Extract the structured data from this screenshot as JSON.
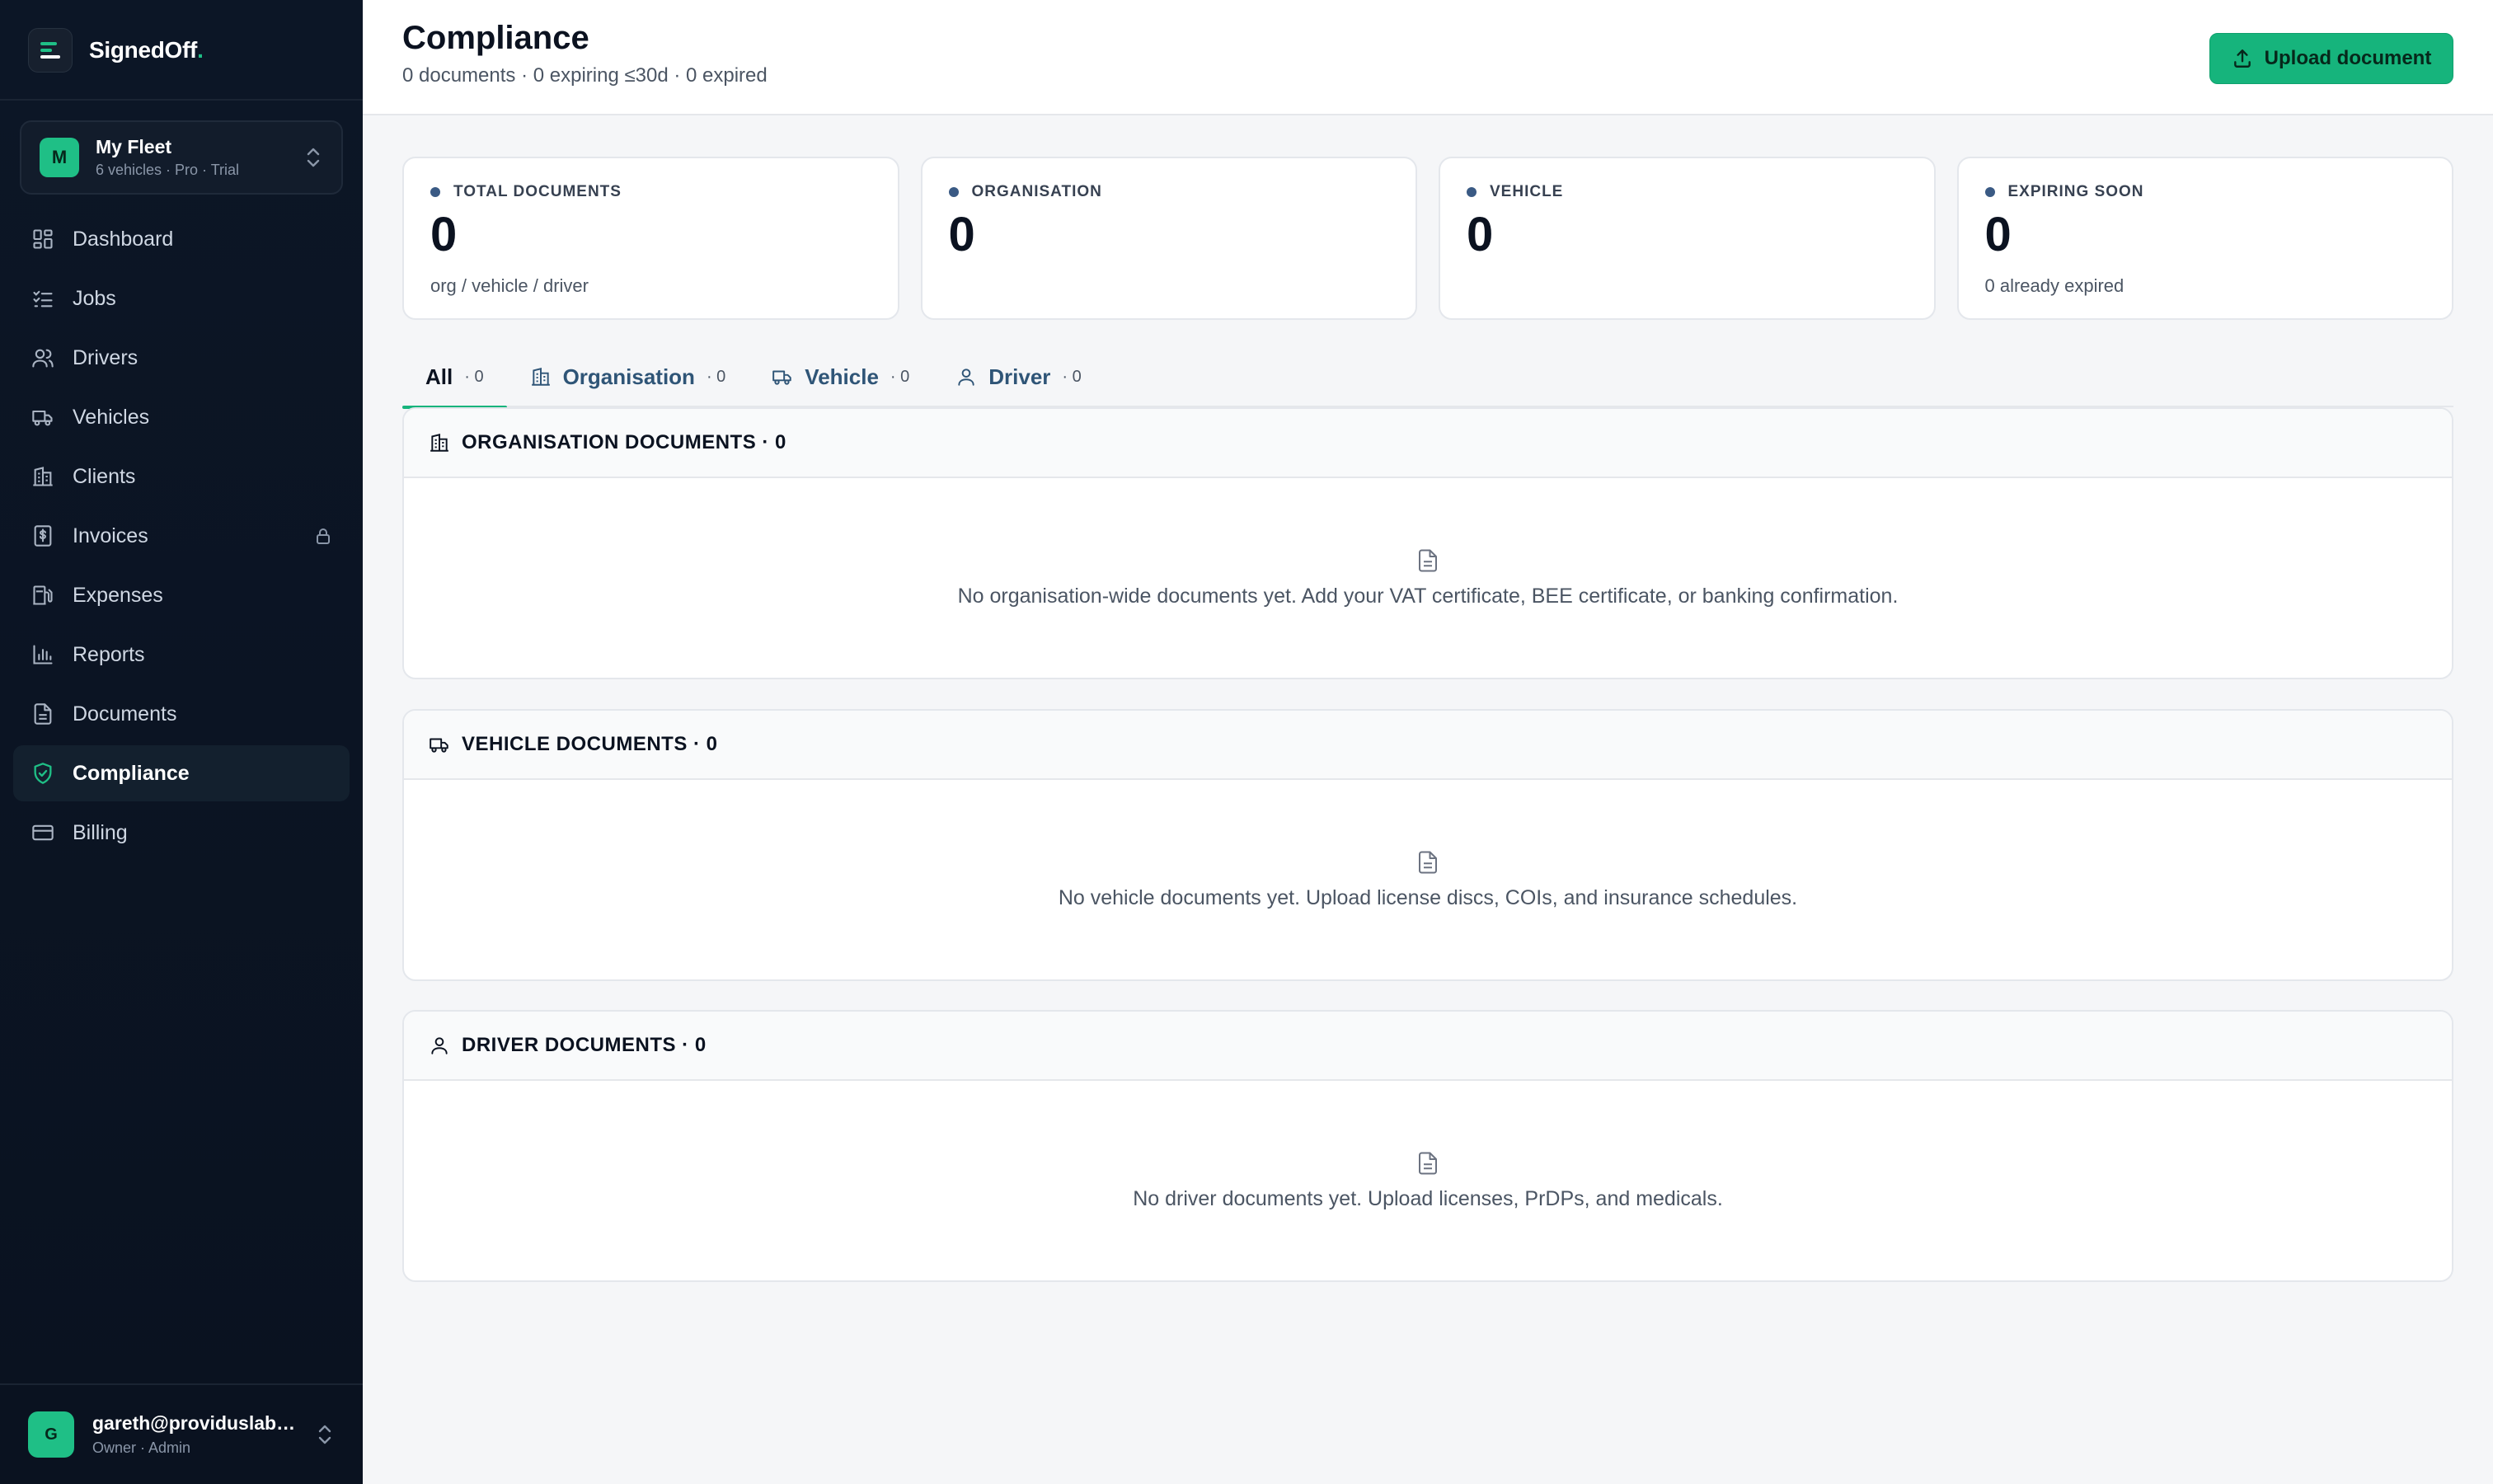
{
  "brand": {
    "name": "SignedOff",
    "dot": "."
  },
  "org": {
    "initial": "M",
    "name": "My Fleet",
    "meta": "6 vehicles · Pro · Trial"
  },
  "nav": [
    {
      "label": "Dashboard",
      "icon": "dashboard-icon"
    },
    {
      "label": "Jobs",
      "icon": "checklist-icon"
    },
    {
      "label": "Drivers",
      "icon": "users-icon"
    },
    {
      "label": "Vehicles",
      "icon": "truck-icon"
    },
    {
      "label": "Clients",
      "icon": "building-icon"
    },
    {
      "label": "Invoices",
      "icon": "dollar-document-icon",
      "locked": true
    },
    {
      "label": "Expenses",
      "icon": "fuel-icon"
    },
    {
      "label": "Reports",
      "icon": "bar-chart-icon"
    },
    {
      "label": "Documents",
      "icon": "file-icon"
    },
    {
      "label": "Compliance",
      "icon": "shield-check-icon",
      "active": true
    },
    {
      "label": "Billing",
      "icon": "credit-card-icon"
    }
  ],
  "user": {
    "initial": "G",
    "email": "gareth@providuslabs.co",
    "role": "Owner · Admin"
  },
  "header": {
    "title": "Compliance",
    "subtitle": "0 documents · 0 expiring ≤30d · 0 expired",
    "upload_label": "Upload document"
  },
  "stats": [
    {
      "label": "TOTAL DOCUMENTS",
      "value": "0",
      "note": "org / vehicle / driver"
    },
    {
      "label": "ORGANISATION",
      "value": "0",
      "note": ""
    },
    {
      "label": "VEHICLE",
      "value": "0",
      "note": ""
    },
    {
      "label": "EXPIRING SOON",
      "value": "0",
      "note": "0 already expired"
    }
  ],
  "tabs": [
    {
      "label": "All",
      "count": "· 0"
    },
    {
      "label": "Organisation",
      "count": "· 0"
    },
    {
      "label": "Vehicle",
      "count": "· 0"
    },
    {
      "label": "Driver",
      "count": "· 0"
    }
  ],
  "sections": [
    {
      "title": "ORGANISATION DOCUMENTS · 0",
      "empty": "No organisation-wide documents yet. Add your VAT certificate, BEE certificate, or banking confirmation."
    },
    {
      "title": "VEHICLE DOCUMENTS · 0",
      "empty": "No vehicle documents yet. Upload license discs, COIs, and insurance schedules."
    },
    {
      "title": "DRIVER DOCUMENTS · 0",
      "empty": "No driver documents yet. Upload licenses, PrDPs, and medicals."
    }
  ],
  "colors": {
    "accent": "#16b47c",
    "sidebar": "#0c1626",
    "link": "#2f5577"
  }
}
